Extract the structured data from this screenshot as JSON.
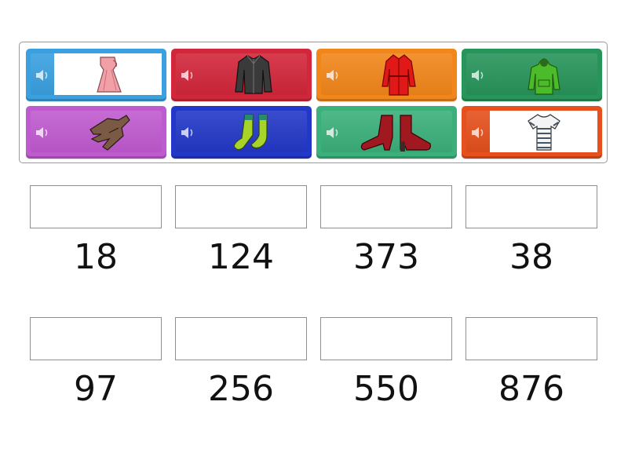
{
  "tiles": [
    {
      "item": "skirt-icon",
      "color": "#3aa0e0",
      "white_bg": true
    },
    {
      "item": "jacket-icon",
      "color": "#d2263a",
      "white_bg": false
    },
    {
      "item": "coat-icon",
      "color": "#f2861a",
      "white_bg": false
    },
    {
      "item": "hoodie-icon",
      "color": "#27945a",
      "white_bg": false
    },
    {
      "item": "gloves-icon",
      "color": "#c05ad0",
      "white_bg": false
    },
    {
      "item": "socks-icon",
      "color": "#2338c8",
      "white_bg": false
    },
    {
      "item": "boots-icon",
      "color": "#3bb07a",
      "white_bg": false
    },
    {
      "item": "tshirt-icon",
      "color": "#e5501c",
      "white_bg": true
    }
  ],
  "numbers": [
    "18",
    "124",
    "373",
    "38",
    "97",
    "256",
    "550",
    "876"
  ]
}
